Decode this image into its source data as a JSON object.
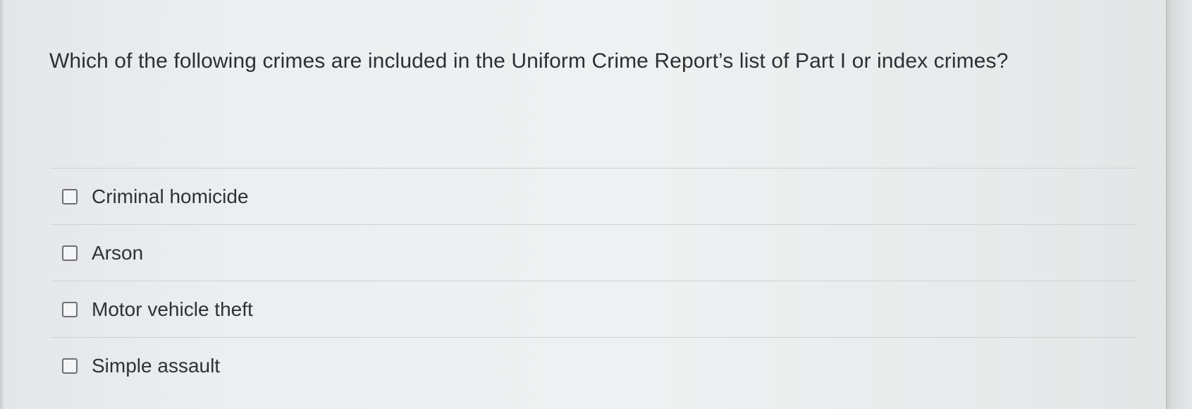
{
  "question": {
    "text": "Which of the following crimes are included in the Uniform Crime Report’s list of Part I or index crimes?"
  },
  "options": [
    {
      "label": "Criminal homicide",
      "checked": false
    },
    {
      "label": "Arson",
      "checked": false
    },
    {
      "label": "Motor vehicle theft",
      "checked": false
    },
    {
      "label": "Simple assault",
      "checked": false
    }
  ]
}
